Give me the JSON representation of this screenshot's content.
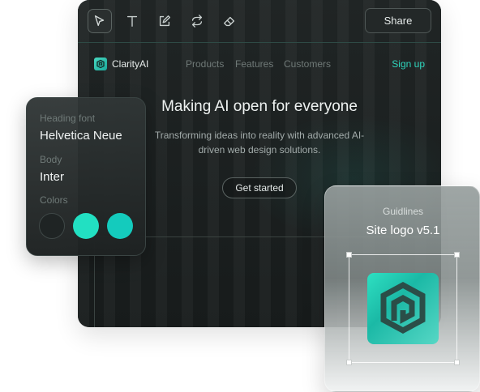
{
  "toolbar": {
    "tools": [
      "pointer-icon",
      "text-icon",
      "edit-icon",
      "repeat-icon",
      "eraser-icon"
    ],
    "share_label": "Share"
  },
  "site": {
    "brand": "ClarityAI",
    "nav": [
      "Products",
      "Features",
      "Customers"
    ],
    "signup": "Sign up",
    "hero_title": "Making AI open for everyone",
    "hero_subtitle": "Transforming ideas into reality with advanced AI-driven web design solutions.",
    "cta": "Get started"
  },
  "typography": {
    "heading_label": "Heading font",
    "heading_value": "Helvetica Neue",
    "body_label": "Body",
    "body_value": "Inter",
    "colors_label": "Colors",
    "colors": [
      "#1f2424",
      "#22e0c2",
      "#14cbbd"
    ]
  },
  "guidelines": {
    "label": "Guidlines",
    "title": "Site logo v5.1"
  },
  "colors": {
    "accent": "#2fd6bd",
    "background": "#1b1f1f"
  }
}
